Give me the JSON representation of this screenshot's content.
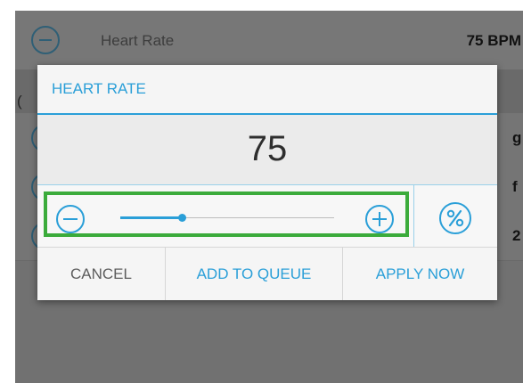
{
  "background": {
    "row1": {
      "label": "Heart Rate",
      "value": "75 BPM"
    },
    "row2_edge_left": "(",
    "row3_edge_right": "g",
    "row4_edge_right": "f",
    "row5_edge_right": "2"
  },
  "dialog": {
    "title": "HEART RATE",
    "value": "75",
    "slider": {
      "min": 0,
      "max": 1,
      "fraction": 0.29
    },
    "buttons": {
      "cancel": "CANCEL",
      "add_to_queue": "ADD TO QUEUE",
      "apply_now": "APPLY NOW"
    },
    "icons": {
      "decrease": "minus-circle-icon",
      "increase": "plus-circle-icon",
      "percent": "percent-circle-icon"
    }
  },
  "colors": {
    "accent": "#2a9fd8",
    "highlight": "#3bab3b",
    "overlay": "#717171"
  }
}
